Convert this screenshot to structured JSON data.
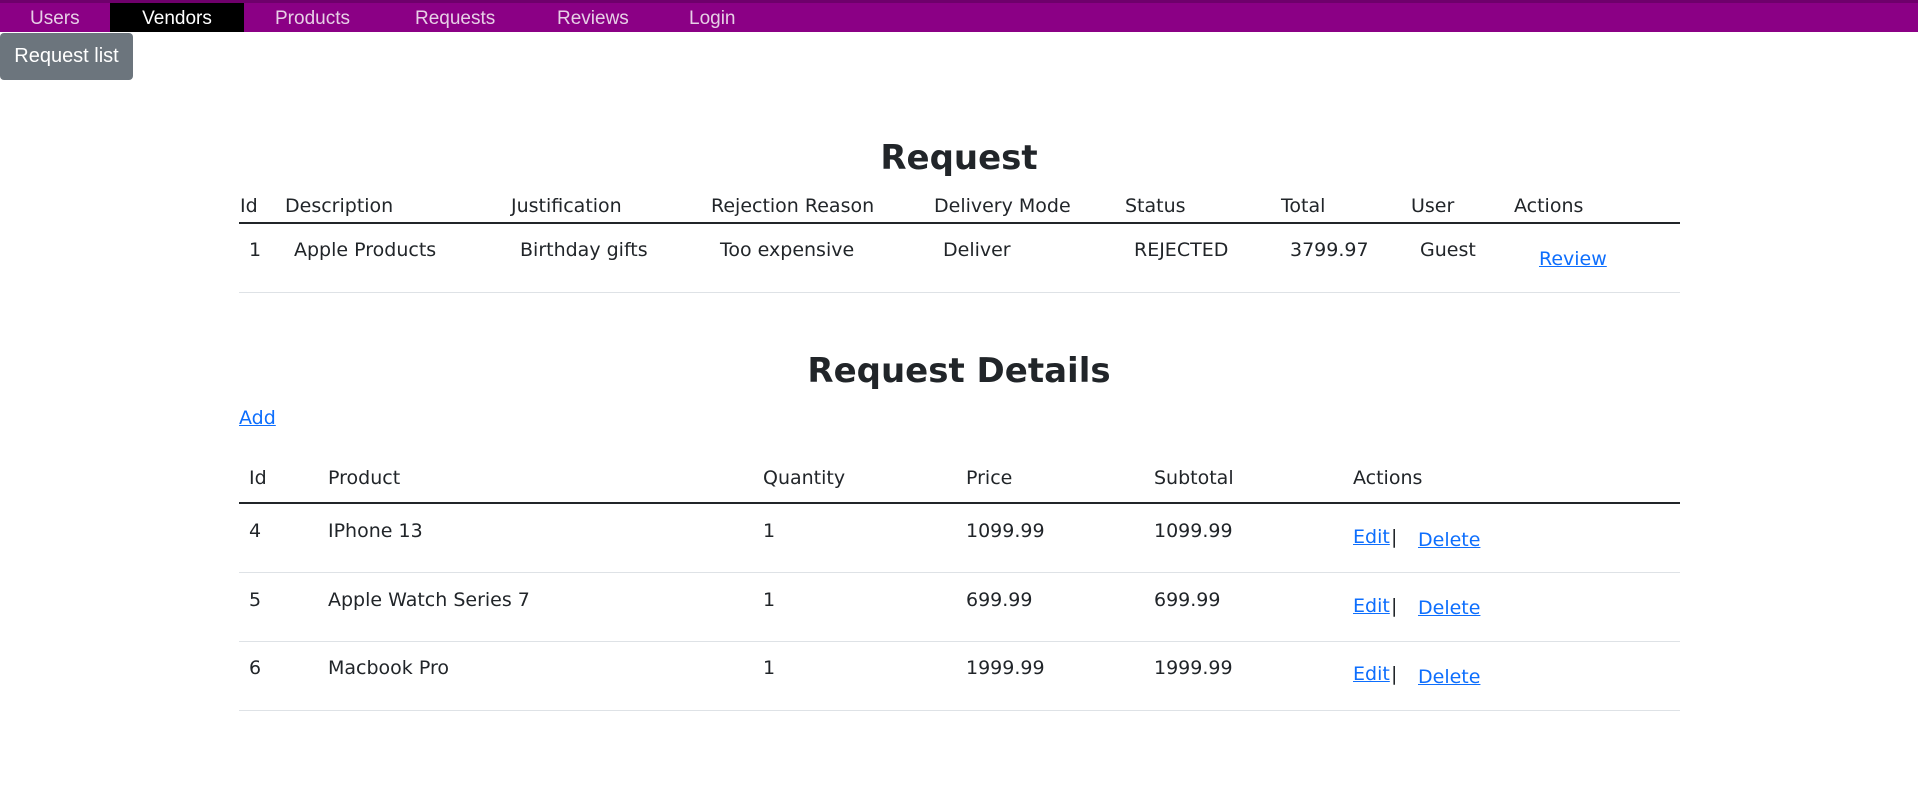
{
  "nav": {
    "items": [
      "Users",
      "Vendors",
      "Products",
      "Requests",
      "Reviews",
      "Login"
    ],
    "active": "Vendors"
  },
  "request_list_button": "Request list",
  "request": {
    "title": "Request",
    "headers": [
      "Id",
      "Description",
      "Justification",
      "Rejection Reason",
      "Delivery Mode",
      "Status",
      "Total",
      "User",
      "Actions"
    ],
    "row": {
      "id": "1",
      "description": "Apple Products",
      "justification": "Birthday gifts",
      "rejection_reason": "Too expensive",
      "delivery_mode": "Deliver",
      "status": "REJECTED",
      "total": "3799.97",
      "user": "Guest",
      "action": "Review"
    }
  },
  "details": {
    "title": "Request Details",
    "add_label": "Add",
    "headers": [
      "Id",
      "Product",
      "Quantity",
      "Price",
      "Subtotal",
      "Actions"
    ],
    "rows": [
      {
        "id": "4",
        "product": "IPhone 13",
        "quantity": "1",
        "price": "1099.99",
        "subtotal": "1099.99"
      },
      {
        "id": "5",
        "product": "Apple Watch Series 7",
        "quantity": "1",
        "price": "699.99",
        "subtotal": "699.99"
      },
      {
        "id": "6",
        "product": "Macbook Pro",
        "quantity": "1",
        "price": "1999.99",
        "subtotal": "1999.99"
      }
    ],
    "edit_label": "Edit",
    "separator": "|",
    "delete_label": "Delete"
  }
}
